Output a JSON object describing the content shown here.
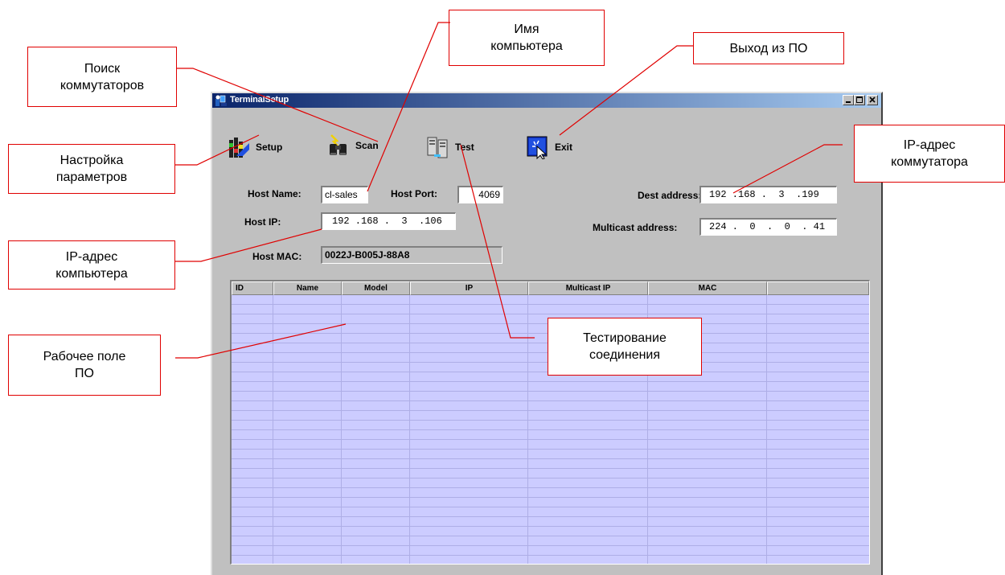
{
  "window": {
    "title": "TerminalSetup"
  },
  "toolbar": {
    "setup_label": "Setup",
    "scan_label": "Scan",
    "test_label": "Test",
    "exit_label": "Exit"
  },
  "form": {
    "host_name_label": "Host Name:",
    "host_name_value": "cl-sales",
    "host_port_label": "Host Port:",
    "host_port_value": "4069",
    "host_ip_label": "Host IP:",
    "host_ip_value": "192 .168 .  3  .106",
    "host_mac_label": "Host MAC:",
    "host_mac_value": "0022J-B005J-88A8",
    "dest_label": "Dest address:",
    "dest_value": "192 .168 .  3  .199",
    "multicast_label": "Multicast address:",
    "multicast_value": "224 .  0  .  0  . 41"
  },
  "table": {
    "columns": [
      "ID",
      "Name",
      "Model",
      "IP",
      "Multicast IP",
      "MAC",
      ""
    ],
    "rows": []
  },
  "callouts": {
    "search": "Поиск\nкоммутаторов",
    "pc_name": "Имя\nкомпьютера",
    "exit": "Выход из ПО",
    "setup": "Настройка\nпараметров",
    "switch_ip": "IP-адрес\nкоммутатора",
    "pc_ip": "IP-адрес\nкомпьютера",
    "workspace": "Рабочее поле\nПО",
    "test": "Тестирование\nсоединения"
  },
  "colors": {
    "callout_border": "#e00000",
    "leader_line": "#e00000",
    "window_bg": "#c0c0c0",
    "grid_bg": "#ccccff",
    "title_gradient_start": "#0a246a",
    "title_gradient_end": "#a6caf0"
  },
  "icons": {
    "title": "terminal-setup-app-icon",
    "setup": "setup-icon",
    "scan": "binoculars-icon",
    "test": "computers-icon",
    "exit": "exit-icon"
  }
}
